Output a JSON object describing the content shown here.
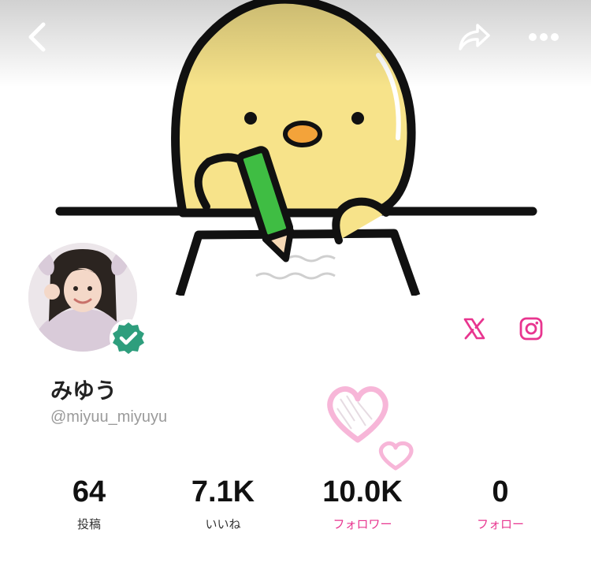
{
  "header": {
    "back_icon": "chevron-left-icon",
    "share_icon": "share-icon",
    "more_icon": "more-dots-icon"
  },
  "cover": {
    "image": "yellow-chick-writing-illustration"
  },
  "profile": {
    "display_name": "みゆう",
    "handle": "@miyuu_miyuyu",
    "verified": true,
    "avatar": "profile-photo"
  },
  "social_links": [
    {
      "name": "x-icon"
    },
    {
      "name": "instagram-icon"
    }
  ],
  "stats": [
    {
      "value": "64",
      "label": "投稿",
      "style": "dark"
    },
    {
      "value": "7.1K",
      "label": "いいね",
      "style": "dark"
    },
    {
      "value": "10.0K",
      "label": "フォロワー",
      "style": "pink"
    },
    {
      "value": "0",
      "label": "フォロー",
      "style": "pink"
    }
  ],
  "colors": {
    "accent_pink": "#e8358f",
    "verified_green": "#2e9e7d",
    "chick_yellow": "#f7e38a"
  }
}
